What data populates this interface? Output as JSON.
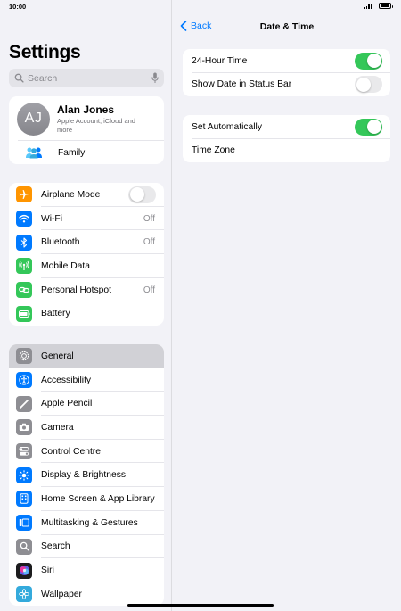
{
  "status": {
    "time": "10:00"
  },
  "sidebar": {
    "title": "Settings",
    "search_placeholder": "Search",
    "profile": {
      "initials": "AJ",
      "name": "Alan Jones",
      "subtitle": "Apple Account, iCloud and more",
      "family_label": "Family"
    },
    "connectivity": [
      {
        "label": "Airplane Mode",
        "icon": "airplane-icon",
        "color": "#ff9500",
        "toggle": false
      },
      {
        "label": "Wi-Fi",
        "icon": "wifi-icon",
        "color": "#007aff",
        "value": "Off"
      },
      {
        "label": "Bluetooth",
        "icon": "bluetooth-icon",
        "color": "#007aff",
        "value": "Off"
      },
      {
        "label": "Mobile Data",
        "icon": "antenna-icon",
        "color": "#34c759"
      },
      {
        "label": "Personal Hotspot",
        "icon": "link-icon",
        "color": "#34c759",
        "value": "Off"
      },
      {
        "label": "Battery",
        "icon": "battery-icon",
        "color": "#34c759"
      }
    ],
    "system": [
      {
        "label": "General",
        "icon": "gear-icon",
        "color": "#8e8e93",
        "selected": true
      },
      {
        "label": "Accessibility",
        "icon": "accessibility-icon",
        "color": "#007aff"
      },
      {
        "label": "Apple Pencil",
        "icon": "pencil-icon",
        "color": "#8e8e93"
      },
      {
        "label": "Camera",
        "icon": "camera-icon",
        "color": "#8e8e93"
      },
      {
        "label": "Control Centre",
        "icon": "switches-icon",
        "color": "#8e8e93"
      },
      {
        "label": "Display & Brightness",
        "icon": "sun-icon",
        "color": "#007aff"
      },
      {
        "label": "Home Screen & App Library",
        "icon": "home-screen-icon",
        "color": "#007aff"
      },
      {
        "label": "Multitasking & Gestures",
        "icon": "multitasking-icon",
        "color": "#007aff"
      },
      {
        "label": "Search",
        "icon": "search-icon",
        "color": "#8e8e93"
      },
      {
        "label": "Siri",
        "icon": "siri-icon",
        "color": "#1c1c1e"
      },
      {
        "label": "Wallpaper",
        "icon": "flower-icon",
        "color": "#34aadc"
      }
    ]
  },
  "detail": {
    "back_label": "Back",
    "title": "Date & Time",
    "group1": [
      {
        "label": "24-Hour Time",
        "toggle": true
      },
      {
        "label": "Show Date in Status Bar",
        "toggle": false
      }
    ],
    "group2": [
      {
        "label": "Set Automatically",
        "toggle": true
      },
      {
        "label": "Time Zone"
      }
    ]
  },
  "colors": {
    "accent": "#007aff",
    "toggle_on": "#34c759"
  }
}
